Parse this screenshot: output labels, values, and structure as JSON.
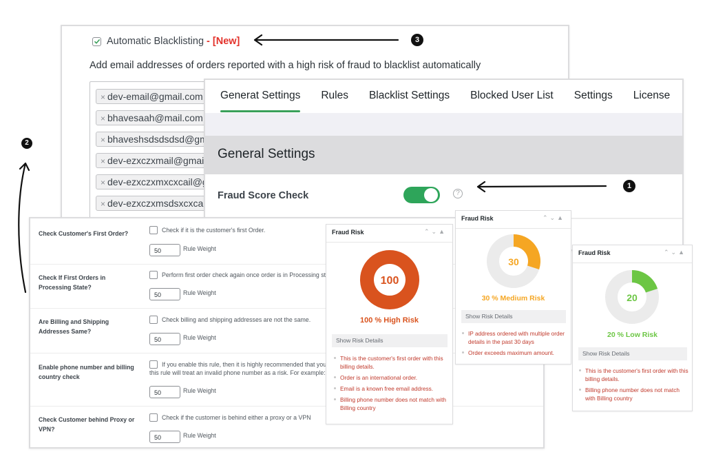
{
  "blacklist_panel": {
    "checkbox_label": "Automatic Blacklisting",
    "new_badge": "- [New]",
    "checked": true,
    "description": "Add email addresses of orders reported with a high risk of fraud to blacklist automatically",
    "emails": [
      "dev-email@gmail.com",
      "bhavesaah@mail.com",
      "bhaveshsdsdsdsd@gmail.com",
      "dev-ezxczxmail@gmail.com",
      "dev-ezxczxmxcxcail@gmail.com",
      "dev-ezxczxmsdsxcxcail@gmail.com"
    ],
    "remove_glyph": "×"
  },
  "settings_panel": {
    "tabs": [
      {
        "label": "Generat Settings",
        "active": true
      },
      {
        "label": "Rules",
        "active": false
      },
      {
        "label": "Blacklist Settings",
        "active": false
      },
      {
        "label": "Blocked User List",
        "active": false
      },
      {
        "label": "Settings",
        "active": false
      },
      {
        "label": "License",
        "active": false
      }
    ],
    "section_title": "General Settings",
    "fraud_score_label": "Fraud Score Check",
    "fraud_score_enabled": true,
    "help_glyph": "?"
  },
  "rules_panel": {
    "weight_label": "Rule Weight",
    "rules": [
      {
        "question": "Check Customer's First Order?",
        "description": [
          "Check if it is the customer's first Order."
        ],
        "weight": "50"
      },
      {
        "question": "Check If First Orders in Processing State?",
        "description": [
          "Perform first order check again once order is in Processing st"
        ],
        "weight": "50"
      },
      {
        "question": "Are Billing and Shipping Addresses Same?",
        "description": [
          "Check billing and shipping addresses are not the same."
        ],
        "weight": "50"
      },
      {
        "question": "Enable phone number and billing country check",
        "description": [
          "If you enable this rule, then it is highly recommended that you",
          "this rule will treat an invalid phone number as a risk. For example:"
        ],
        "weight": "50"
      },
      {
        "question": "Check Customer behind Proxy or VPN?",
        "description": [
          "Check if the customer is behind either a proxy or a VPN"
        ],
        "weight": "50"
      }
    ]
  },
  "widgets": [
    {
      "title": "Fraud Risk",
      "score": 100,
      "score_label": "100",
      "risk_text": "100 % High Risk",
      "color": "#d9531e",
      "details_label": "Show Risk Details",
      "reasons": [
        "This is the customer's first order with this billing details.",
        "Order is an international order.",
        "Email is a known free email address.",
        "Billing phone number does not match with Billing country"
      ]
    },
    {
      "title": "Fraud Risk",
      "score": 30,
      "score_label": "30",
      "risk_text": "30 % Medium Risk",
      "color": "#f5a623",
      "details_label": "Show Risk Details",
      "reasons": [
        "IP address ordered with multiple order details in the past 30 days",
        "Order exceeds maximum amount."
      ]
    },
    {
      "title": "Fraud Risk",
      "score": 20,
      "score_label": "20",
      "risk_text": "20 % Low Risk",
      "color": "#6cc644",
      "details_label": "Show Risk Details",
      "reasons": [
        "This is the customer's first order with this billing details.",
        "Billing phone number does not match with Billing country"
      ]
    }
  ],
  "widget_controls": {
    "up": "^",
    "down": "v",
    "collapse": "▲"
  },
  "annotations": [
    {
      "number": "1"
    },
    {
      "number": "2"
    },
    {
      "number": "3"
    }
  ],
  "colors": {
    "toggle_on": "#2ea55a",
    "tab_underline": "#3aa05a",
    "new_badge": "#e3322b",
    "reason_text": "#c0392b",
    "donut_track": "#ebebeb"
  }
}
